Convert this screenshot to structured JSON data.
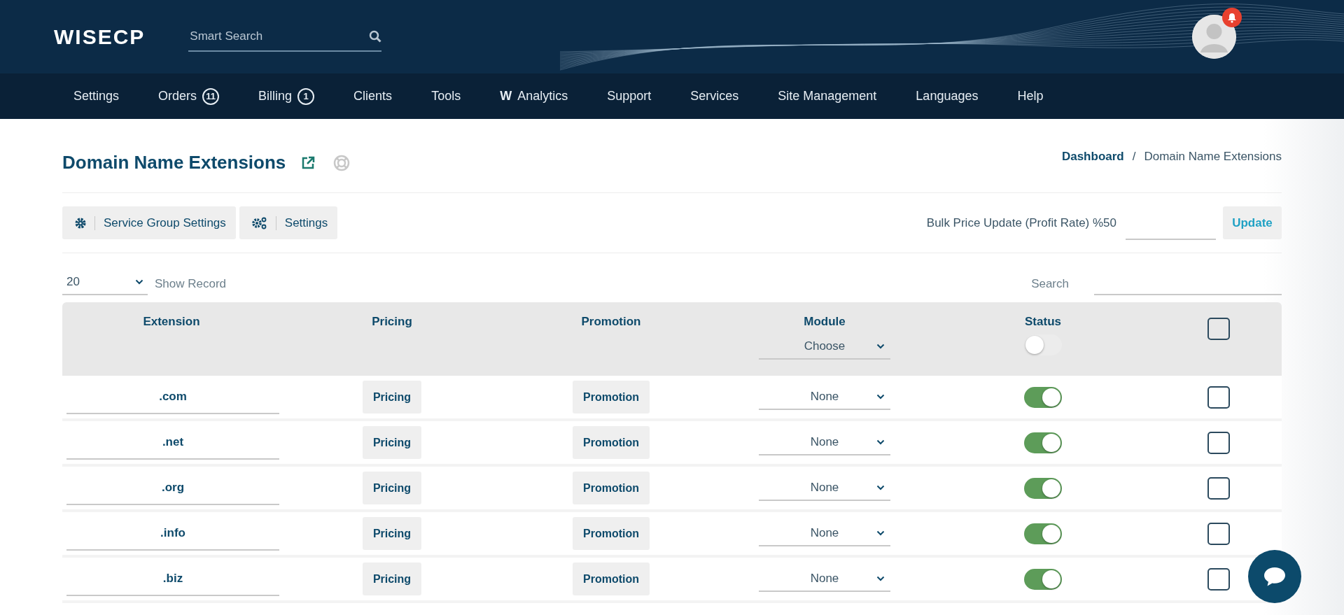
{
  "header": {
    "logo": "WISECP",
    "search": {
      "placeholder": "Smart Search"
    },
    "notification": true
  },
  "nav": [
    {
      "label": "Settings"
    },
    {
      "label": "Orders",
      "badge": "11"
    },
    {
      "label": "Billing",
      "badge": "1"
    },
    {
      "label": "Clients"
    },
    {
      "label": "Tools"
    },
    {
      "label": "**W**Analytics"
    },
    {
      "label": "Support"
    },
    {
      "label": "Services"
    },
    {
      "label": "Site Management"
    },
    {
      "label": "Languages"
    },
    {
      "label": "Help"
    }
  ],
  "page": {
    "title": "Domain Name Extensions",
    "breadcrumb": [
      {
        "label": "Dashboard",
        "kind": "link"
      },
      {
        "label": "/",
        "kind": "separator"
      },
      {
        "label": "Domain Name Extensions",
        "kind": "current"
      }
    ]
  },
  "toolbar": {
    "buttons": [
      {
        "label": "Service Group Settings",
        "kind": "gear"
      },
      {
        "label": "Settings",
        "kind": "gears"
      }
    ],
    "bulk_label": "Bulk Price Update (Profit Rate) %50",
    "update_button": "Update"
  },
  "list_controls": {
    "page_size": "20",
    "page_size_label": "Show Record",
    "search_label": "Search"
  },
  "table": {
    "columns": [
      {
        "label": "Extension"
      },
      {
        "label": "Pricing"
      },
      {
        "label": "Promotion"
      },
      {
        "label": "Module",
        "filter": "Choose"
      },
      {
        "label": "Status",
        "toggle_on": false
      },
      {
        "kind": "select-all",
        "checked": false
      }
    ],
    "rows": [
      {
        "extension": ".com",
        "pricing": "Pricing",
        "promotion": "Promotion",
        "module": "None",
        "status_on": true,
        "checked": false
      },
      {
        "extension": ".net",
        "pricing": "Pricing",
        "promotion": "Promotion",
        "module": "None",
        "status_on": true,
        "checked": false
      },
      {
        "extension": ".org",
        "pricing": "Pricing",
        "promotion": "Promotion",
        "module": "None",
        "status_on": true,
        "checked": false
      },
      {
        "extension": ".info",
        "pricing": "Pricing",
        "promotion": "Promotion",
        "module": "None",
        "status_on": true,
        "checked": false
      },
      {
        "extension": ".biz",
        "pricing": "Pricing",
        "promotion": "Promotion",
        "module": "None",
        "status_on": true,
        "checked": false
      }
    ]
  }
}
